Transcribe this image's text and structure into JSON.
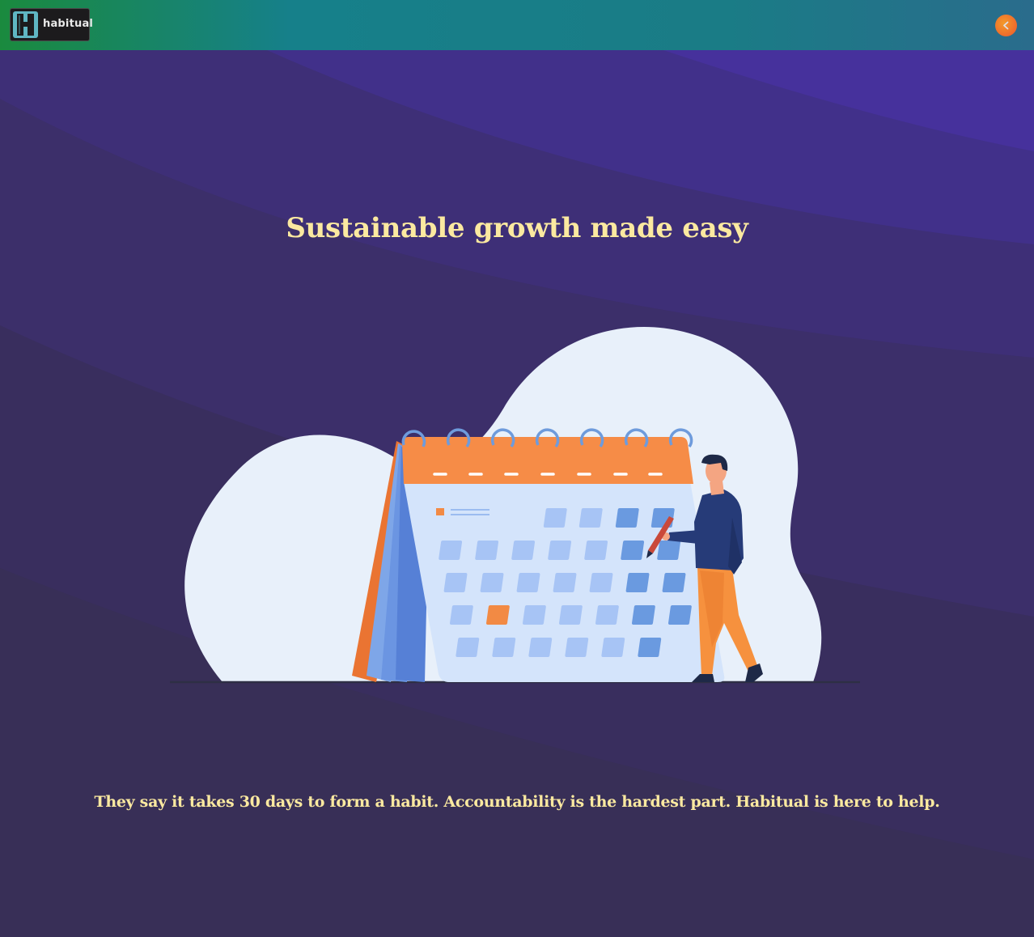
{
  "app": {
    "logo_text": "habitual",
    "logo_icon": "habitual-h-icon",
    "back_icon": "chevron-left-icon"
  },
  "hero": {
    "title": "Sustainable growth made easy",
    "tagline": "They say it takes 30 days to form a habit. Accountability is the hardest part. Habitual is here to help."
  },
  "colors": {
    "accent": "#fbe9a0",
    "header_green": "#1a8a3e",
    "header_teal": "#16808a",
    "back_button": "#ee6a2c",
    "background": "#3a3158",
    "calendar_orange": "#f28a44",
    "calendar_blue": "#a7c4f5"
  },
  "illustration": {
    "icon": "calendar-with-person-icon"
  }
}
